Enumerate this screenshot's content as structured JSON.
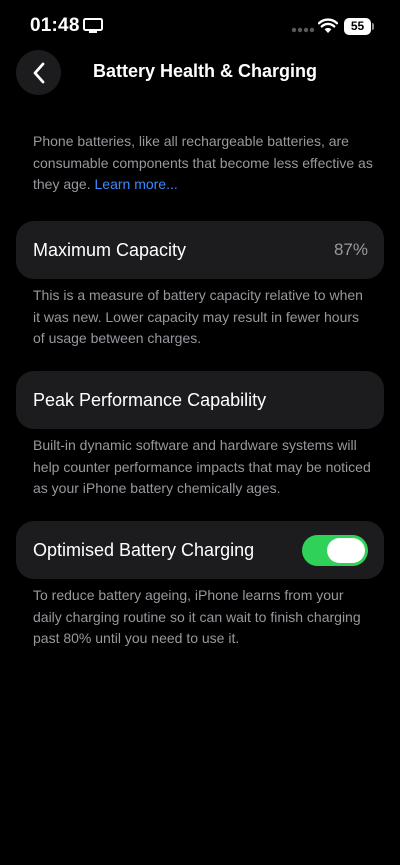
{
  "status_bar": {
    "time": "01:48",
    "battery_level": "55"
  },
  "header": {
    "title": "Battery Health & Charging"
  },
  "intro": {
    "text": "Phone batteries, like all rechargeable batteries, are consumable components that become less effective as they age. ",
    "link": "Learn more..."
  },
  "maximum_capacity": {
    "label": "Maximum Capacity",
    "value": "87%",
    "description": "This is a measure of battery capacity relative to when it was new. Lower capacity may result in fewer hours of usage between charges."
  },
  "peak_performance": {
    "label": "Peak Performance Capability",
    "description": "Built-in dynamic software and hardware systems will help counter performance impacts that may be noticed as your iPhone battery chemically ages."
  },
  "optimised_charging": {
    "label": "Optimised Battery Charging",
    "enabled": true,
    "toggle_color": "#30d158",
    "description": "To reduce battery ageing, iPhone learns from your daily charging routine so it can wait to finish charging past 80% until you need to use it."
  },
  "icons": {
    "back": "chevron-left-icon",
    "screen_mirroring": "screen-mirroring-icon",
    "wifi": "wifi-icon",
    "battery": "battery-icon"
  },
  "colors": {
    "background": "#000000",
    "cell": "#1c1c1e",
    "secondary_text": "#98989f",
    "link": "#3a8bff"
  }
}
